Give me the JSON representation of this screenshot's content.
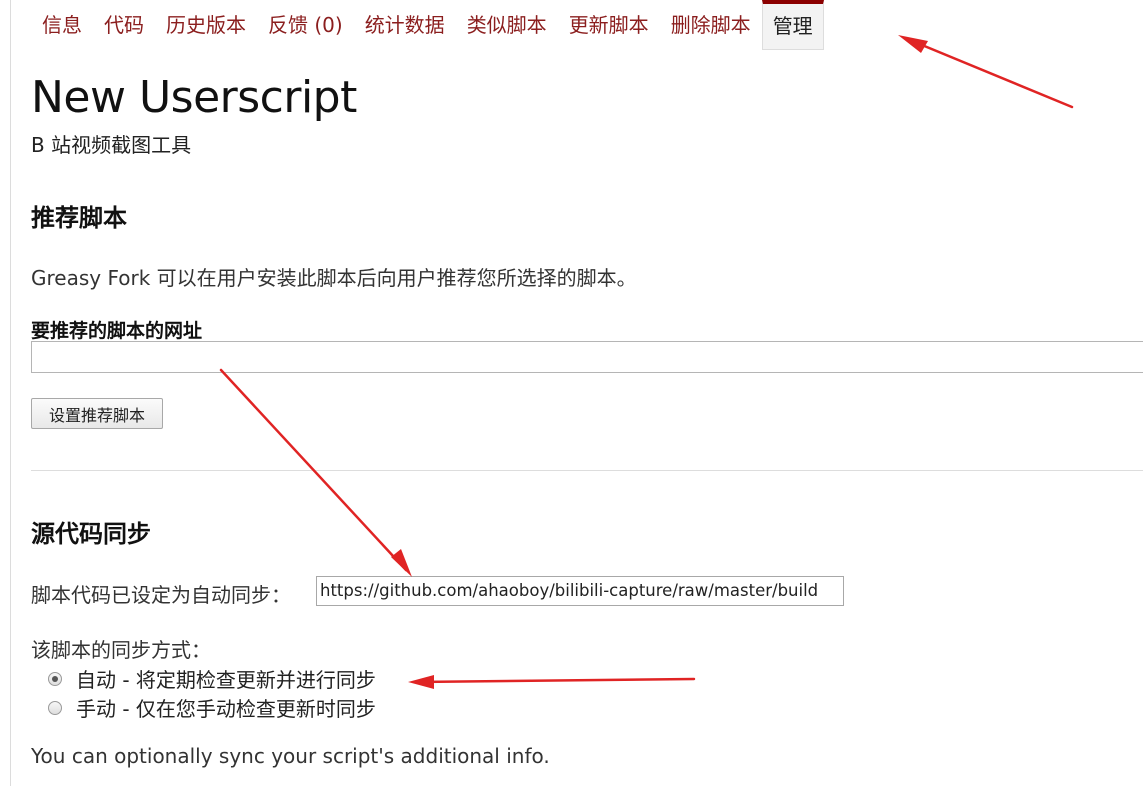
{
  "tabs": [
    {
      "label": "信息"
    },
    {
      "label": "代码"
    },
    {
      "label": "历史版本"
    },
    {
      "label": "反馈 (0)"
    },
    {
      "label": "统计数据"
    },
    {
      "label": "类似脚本"
    },
    {
      "label": "更新脚本"
    },
    {
      "label": "删除脚本"
    },
    {
      "label": "管理"
    }
  ],
  "header": {
    "title": "New Userscript",
    "subtitle": "B 站视频截图工具"
  },
  "recommend": {
    "heading": "推荐脚本",
    "description": "Greasy Fork 可以在用户安装此脚本后向用户推荐您所选择的脚本。",
    "field_label": "要推荐的脚本的网址",
    "input_value": "",
    "button_label": "设置推荐脚本"
  },
  "sync": {
    "heading": "源代码同步",
    "auto_label": "脚本代码已设定为自动同步：",
    "url_value": "https://github.com/ahaoboy/bilibili-capture/raw/master/build",
    "method_label": "该脚本的同步方式：",
    "options": [
      {
        "label": "自动 - 将定期检查更新并进行同步",
        "checked": true
      },
      {
        "label": "手动 - 仅在您手动检查更新时同步",
        "checked": false
      }
    ],
    "additional_info": "You can optionally sync your script's additional info."
  },
  "colors": {
    "tab_link": "#8b1e1e",
    "tab_update": "#2d6d2d",
    "active_tab_top": "#8b0000",
    "annotation_arrow": "#e02424"
  }
}
